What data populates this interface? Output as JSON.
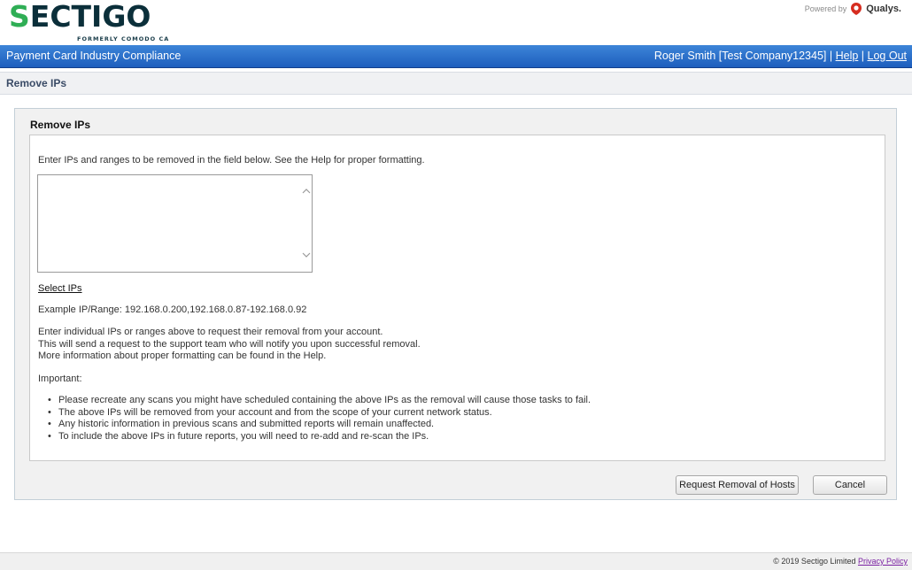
{
  "header": {
    "logo_text": "SECTIGO",
    "logo_subtext": "FORMERLY COMODO CA",
    "powered_by": "Powered by",
    "qualys": "Qualys."
  },
  "navbar": {
    "title": "Payment Card Industry Compliance",
    "user": "Roger Smith [Test Company12345]",
    "sep1": " | ",
    "help": "Help",
    "sep2": " | ",
    "logout": "Log Out"
  },
  "page_title": "Remove IPs",
  "panel": {
    "title": "Remove IPs",
    "intro": "Enter IPs and ranges to be removed in the field below. See the Help for proper formatting.",
    "ip_input": {
      "value": "",
      "placeholder": ""
    },
    "select_ips": "Select IPs",
    "example": "Example IP/Range: 192.168.0.200,192.168.0.87-192.168.0.92",
    "info_lines": [
      "Enter individual IPs or ranges above to request their removal from your account.",
      "This will send a request to the support team who will notify you upon successful removal.",
      "More information about proper formatting can be found in the Help."
    ],
    "important": "Important:",
    "bullets": [
      "Please recreate any scans you might have scheduled containing the above IPs as the removal will cause those tasks to fail.",
      "The above IPs will be removed from your account and from the scope of your current network status.",
      "Any historic information in previous scans and submitted reports will remain unaffected.",
      "To include the above IPs in future reports, you will need to re-add and re-scan the IPs."
    ]
  },
  "buttons": {
    "request": "Request Removal of Hosts",
    "cancel": "Cancel"
  },
  "footer": {
    "copyright": "© 2019 Sectigo Limited",
    "privacy": "Privacy Policy"
  },
  "colors": {
    "navbar_top": "#3d85d8",
    "navbar_bottom": "#1d5ebd",
    "logo_green": "#2fae55",
    "logo_dark": "#0b2f3a",
    "qualys_red": "#d62d20"
  },
  "icons": {
    "qualys_logo": "qualys-shield-icon",
    "scroll_up": "chevron-up-icon",
    "scroll_down": "chevron-down-icon"
  }
}
